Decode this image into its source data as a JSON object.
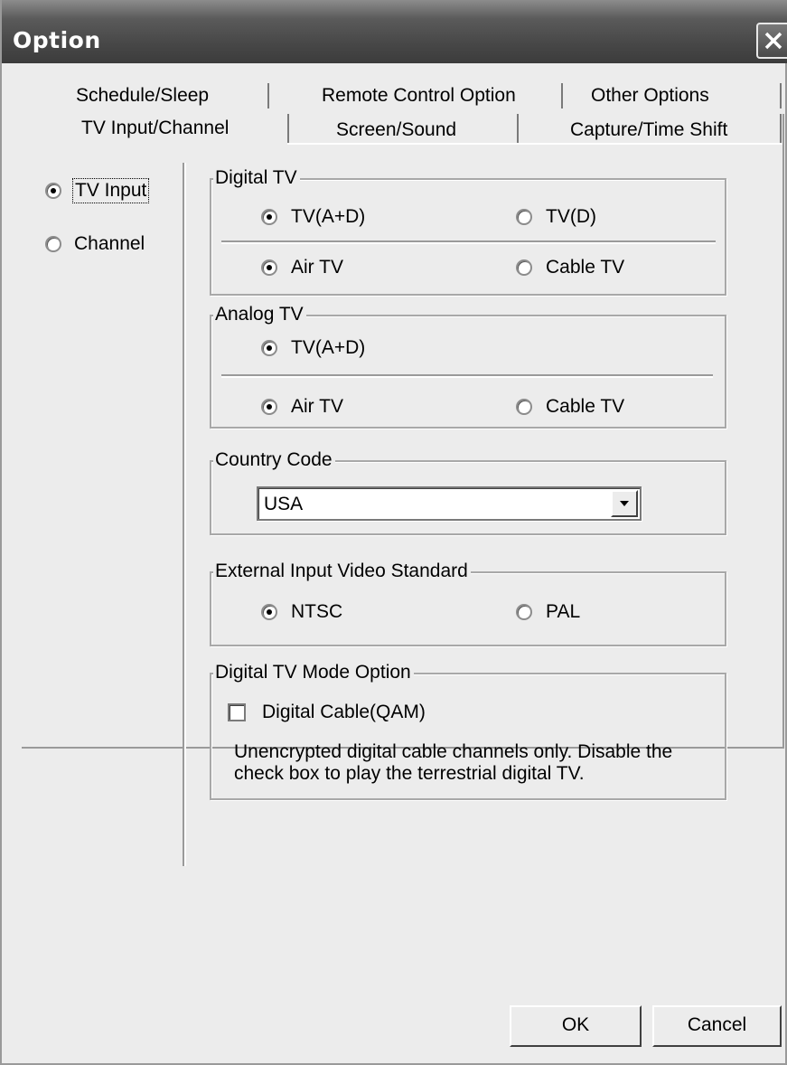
{
  "window": {
    "title": "Option"
  },
  "tabs": {
    "row_back": [
      "Schedule/Sleep",
      "Remote Control Option",
      "Other Options"
    ],
    "row_front": [
      "TV Input/Channel",
      "Screen/Sound",
      "Capture/Time Shift"
    ],
    "active": "TV Input/Channel"
  },
  "sidebar": {
    "tv_input": {
      "label": "TV Input",
      "selected": true
    },
    "channel": {
      "label": "Channel",
      "selected": false
    }
  },
  "digital_tv": {
    "legend": "Digital TV",
    "opt1": {
      "label": "TV(A+D)",
      "selected": true
    },
    "opt2": {
      "label": "TV(D)",
      "selected": false
    },
    "opt3": {
      "label": "Air TV",
      "selected": true
    },
    "opt4": {
      "label": "Cable TV",
      "selected": false
    }
  },
  "analog_tv": {
    "legend": "Analog TV",
    "opt1": {
      "label": "TV(A+D)",
      "selected": true
    },
    "opt3": {
      "label": "Air TV",
      "selected": true
    },
    "opt4": {
      "label": "Cable TV",
      "selected": false
    }
  },
  "country_code": {
    "legend": "Country Code",
    "value": "USA"
  },
  "external_input": {
    "legend": "External Input Video Standard",
    "ntsc": {
      "label": "NTSC",
      "selected": true
    },
    "pal": {
      "label": "PAL",
      "selected": false
    }
  },
  "digital_mode": {
    "legend": "Digital TV Mode Option",
    "checkbox_label": "Digital Cable(QAM)",
    "checked": false,
    "note_line1": "Unencrypted digital cable channels only. Disable the",
    "note_line2": "check box to play the terrestrial digital TV."
  },
  "buttons": {
    "ok": "OK",
    "cancel": "Cancel"
  }
}
